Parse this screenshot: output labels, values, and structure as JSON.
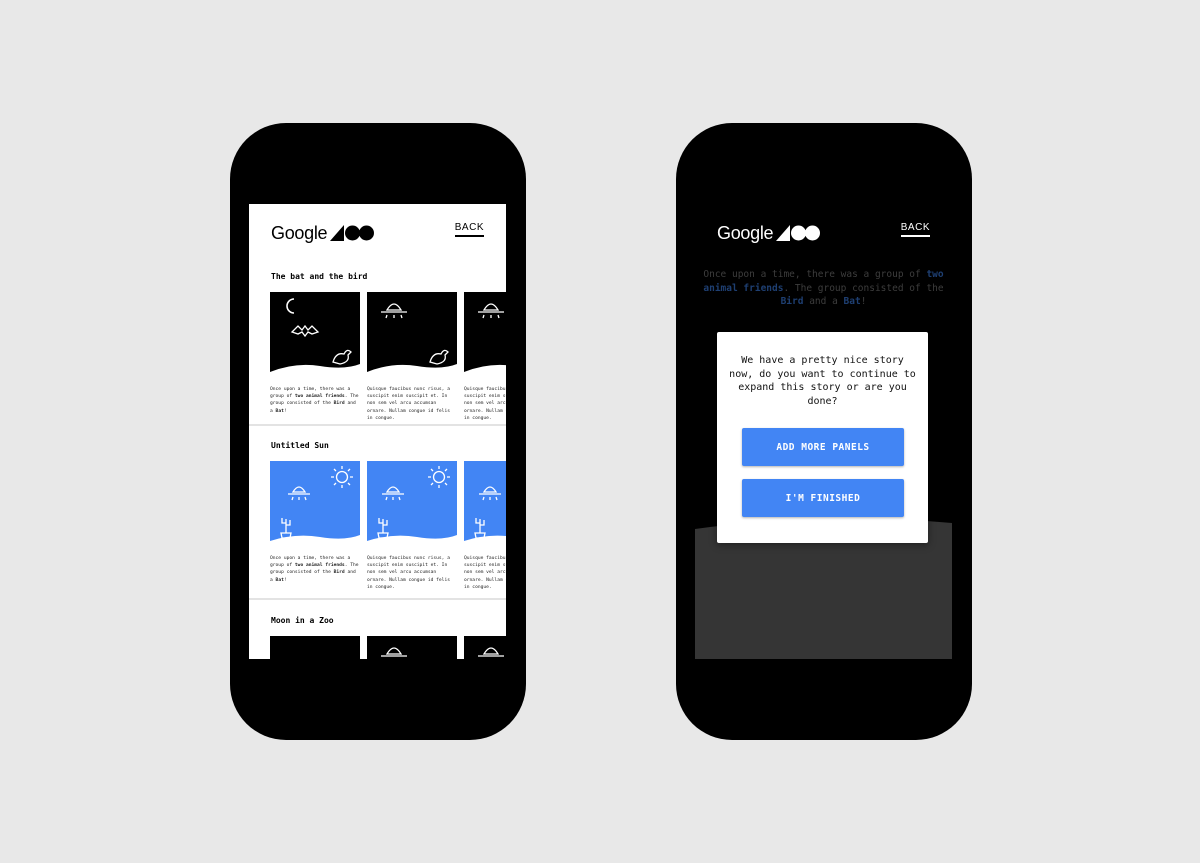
{
  "app": {
    "logo_text": "Google",
    "back_label": "BACK"
  },
  "gallery": {
    "stories": [
      {
        "title": "The bat and the bird",
        "panels": [
          {
            "text_start": "Once upon a time, there was a group of ",
            "bold1": "two animal friends",
            "text_mid": ". The group consisted of the ",
            "bold2": "Bird",
            "text_and": " and a ",
            "bold3": "Bat",
            "text_end": "!"
          },
          {
            "text": "Quisque faucibus nunc risus, a suscipit enim suscipit et. In non sem vel arcu accumsan ornare. Nullam congue id felis in congue."
          },
          {
            "text": "Quisque faucibus nunc risus, a suscipit enim suscipit et. In non sem vel arcu accumsan ornare. Nullam congue id felis in congue."
          }
        ]
      },
      {
        "title": "Untitled Sun",
        "panels": [
          {
            "text_start": "Once upon a time, there was a group of ",
            "bold1": "two animal friends",
            "text_mid": ". The group consisted of the ",
            "bold2": "Bird",
            "text_and": " and a ",
            "bold3": "Bat",
            "text_end": "!"
          },
          {
            "text": "Quisque faucibus nunc risus, a suscipit enim suscipit et. In non sem vel arcu accumsan ornare. Nullam congue id felis in congue."
          },
          {
            "text": "Quisque faucibus nunc risus, a suscipit enim suscipit et. In non sem vel arcu accumsan ornare. Nullam congue id felis in congue."
          }
        ]
      },
      {
        "title": "Moon in a Zoo"
      }
    ]
  },
  "dialog": {
    "intro_start": "Once upon a time, there was a group of ",
    "intro_hl1": "two animal friends",
    "intro_mid": ". The group consisted of the ",
    "intro_hl2": "Bird",
    "intro_and": " and a ",
    "intro_hl3": "Bat",
    "intro_end": "!",
    "prompt": "We have a pretty nice story now, do you want to continue to expand this story or are you done?",
    "add_button": "ADD MORE PANELS",
    "finish_button": "I'M FINISHED"
  },
  "colors": {
    "accent": "#4285f4",
    "night_panel": "#000000",
    "day_panel": "#4285f4",
    "intro_text": "#3d3d3d",
    "intro_highlight": "#1e3f72"
  },
  "icons": [
    "google-400-logo",
    "moon-icon",
    "bat-icon",
    "bird-icon",
    "ufo-icon",
    "sun-icon",
    "cactus-icon"
  ]
}
